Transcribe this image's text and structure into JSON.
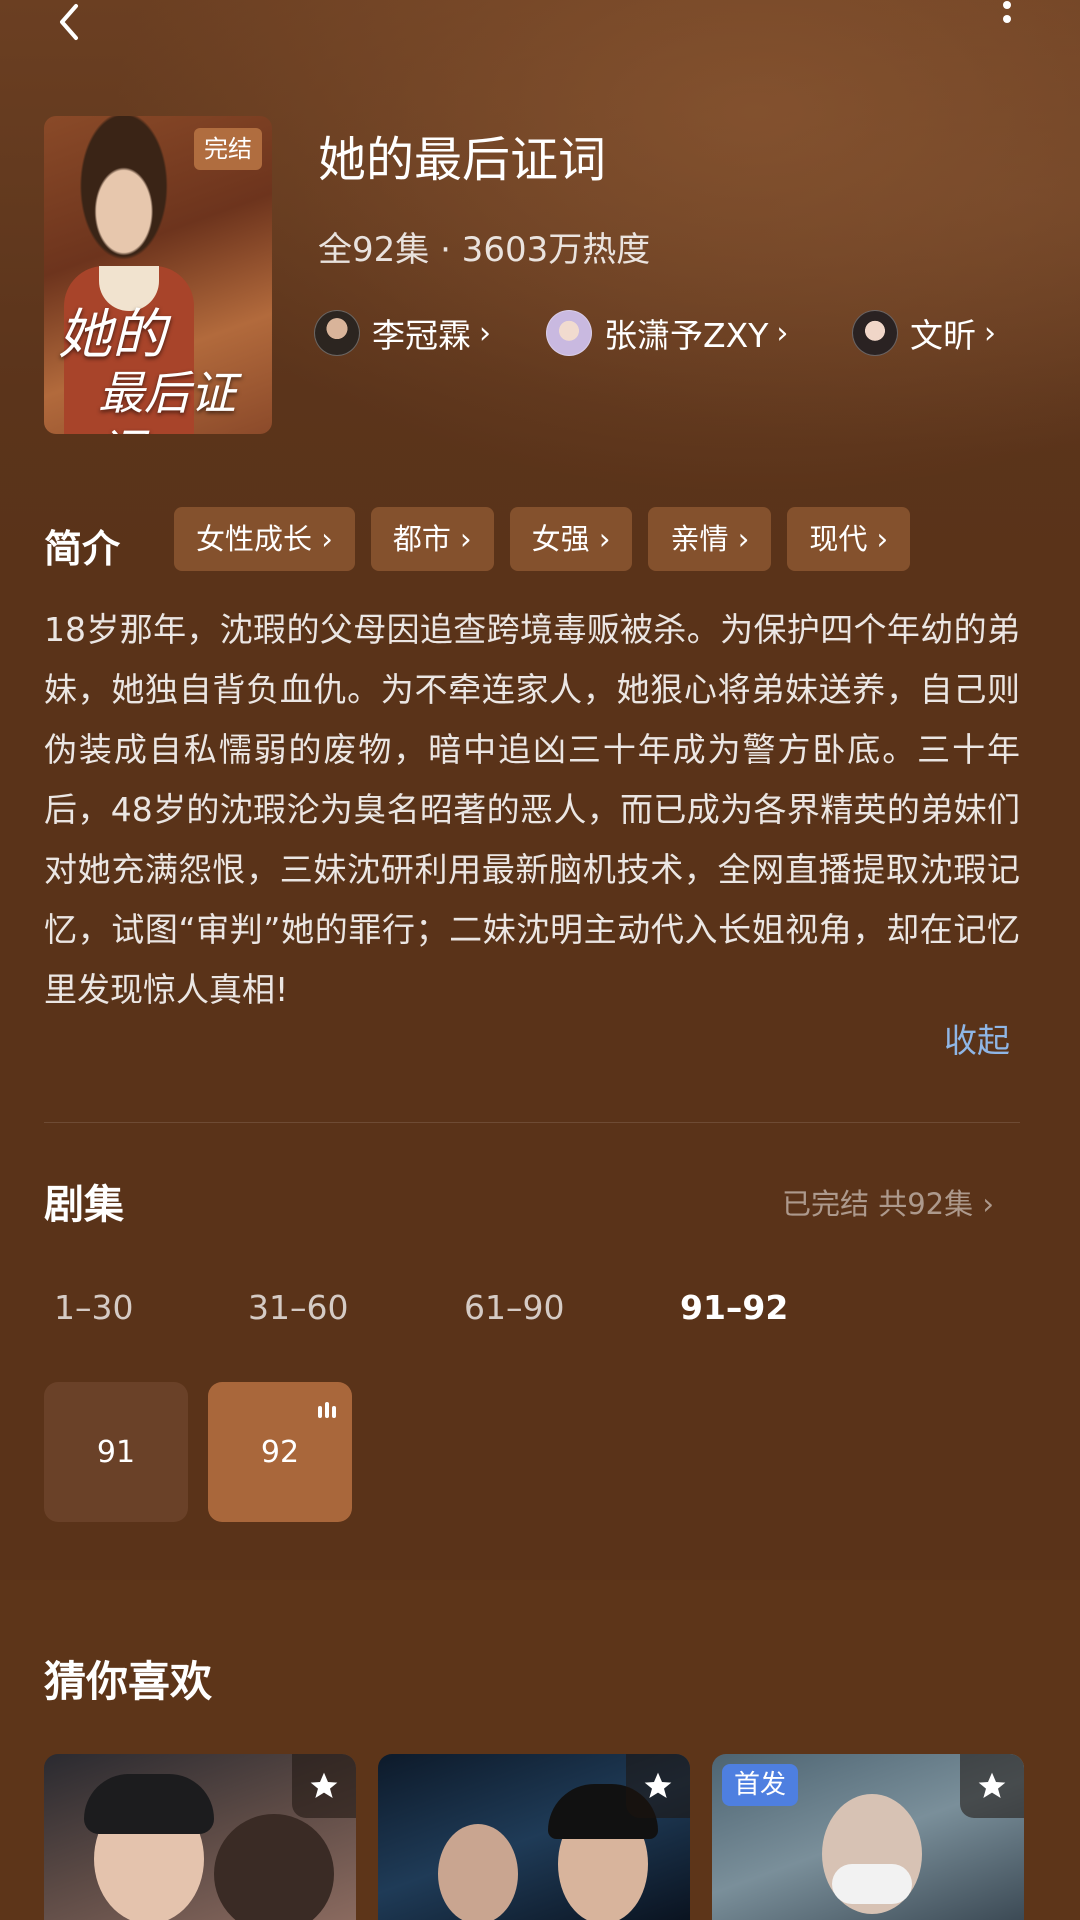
{
  "drama": {
    "title": "她的最后证词",
    "meta": "全92集 · 3603万热度",
    "status_badge": "完结",
    "poster_title_line1": "她的",
    "poster_title_line2": "最后证词"
  },
  "cast": [
    {
      "name": "李冠霖"
    },
    {
      "name": "张潇予ZXY"
    },
    {
      "name": "文昕"
    }
  ],
  "intro": {
    "heading": "简介",
    "tags": [
      "女性成长 ›",
      "都市 ›",
      "女强 ›",
      "亲情 ›",
      "现代 ›"
    ],
    "text": "18岁那年，沈瑕的父母因追查跨境毒贩被杀。为保护四个年幼的弟妹，她独自背负血仇。为不牵连家人，她狠心将弟妹送养，自己则伪装成自私懦弱的废物，暗中追凶三十年成为警方卧底。三十年后，48岁的沈瑕沦为臭名昭著的恶人，而已成为各界精英的弟妹们对她充满怨恨，三妹沈研利用最新脑机技术，全网直播提取沈瑕记忆，试图“审判”她的罪行；二妹沈明主动代入长姐视角，却在记忆里发现惊人真相!",
    "collapse": "收起"
  },
  "episodes": {
    "heading": "剧集",
    "status": "已完结 共92集 ›",
    "ranges": [
      "1–30",
      "31–60",
      "61–90",
      "91–92"
    ],
    "active_range": "91–92",
    "items": [
      "91",
      "92"
    ],
    "playing": "92"
  },
  "recommend": {
    "heading": "猜你喜欢",
    "badge": "首发"
  },
  "colors": {
    "background": "#5a3319",
    "tag_bg": "#84512d",
    "link": "#8fb6e6",
    "episode_active": "#a9673b"
  }
}
